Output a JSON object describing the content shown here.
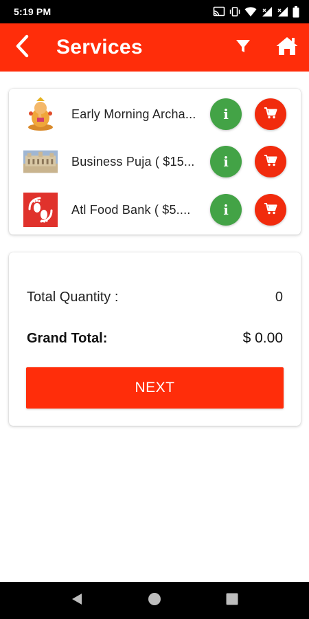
{
  "status_bar": {
    "time": "5:19 PM",
    "icons": [
      "cast-icon",
      "vibrate-icon",
      "wifi-icon",
      "signal-icon",
      "battery-icon"
    ]
  },
  "app_bar": {
    "title": "Services",
    "background": "#ff2d0a",
    "back_icon": "chevron-left-icon",
    "actions": [
      "filter-icon",
      "home-icon"
    ]
  },
  "services": [
    {
      "name": "Early Morning Archa...",
      "thumbnail": "ganesha-image"
    },
    {
      "name": "Business Puja ( $15...",
      "thumbnail": "temple-image"
    },
    {
      "name": "Atl Food Bank ( $5....",
      "thumbnail": "footprints-logo"
    }
  ],
  "colors": {
    "info": "#43a346",
    "cart": "#f12b0d",
    "accent": "#ff2d0a"
  },
  "totals": {
    "quantity_label": "Total Quantity :",
    "quantity_value": "0",
    "grand_label": "Grand Total:",
    "grand_value": "$ 0.00"
  },
  "next_label": "NEXT",
  "nav_bar": [
    "back-triangle-icon",
    "home-circle-icon",
    "recents-square-icon"
  ]
}
